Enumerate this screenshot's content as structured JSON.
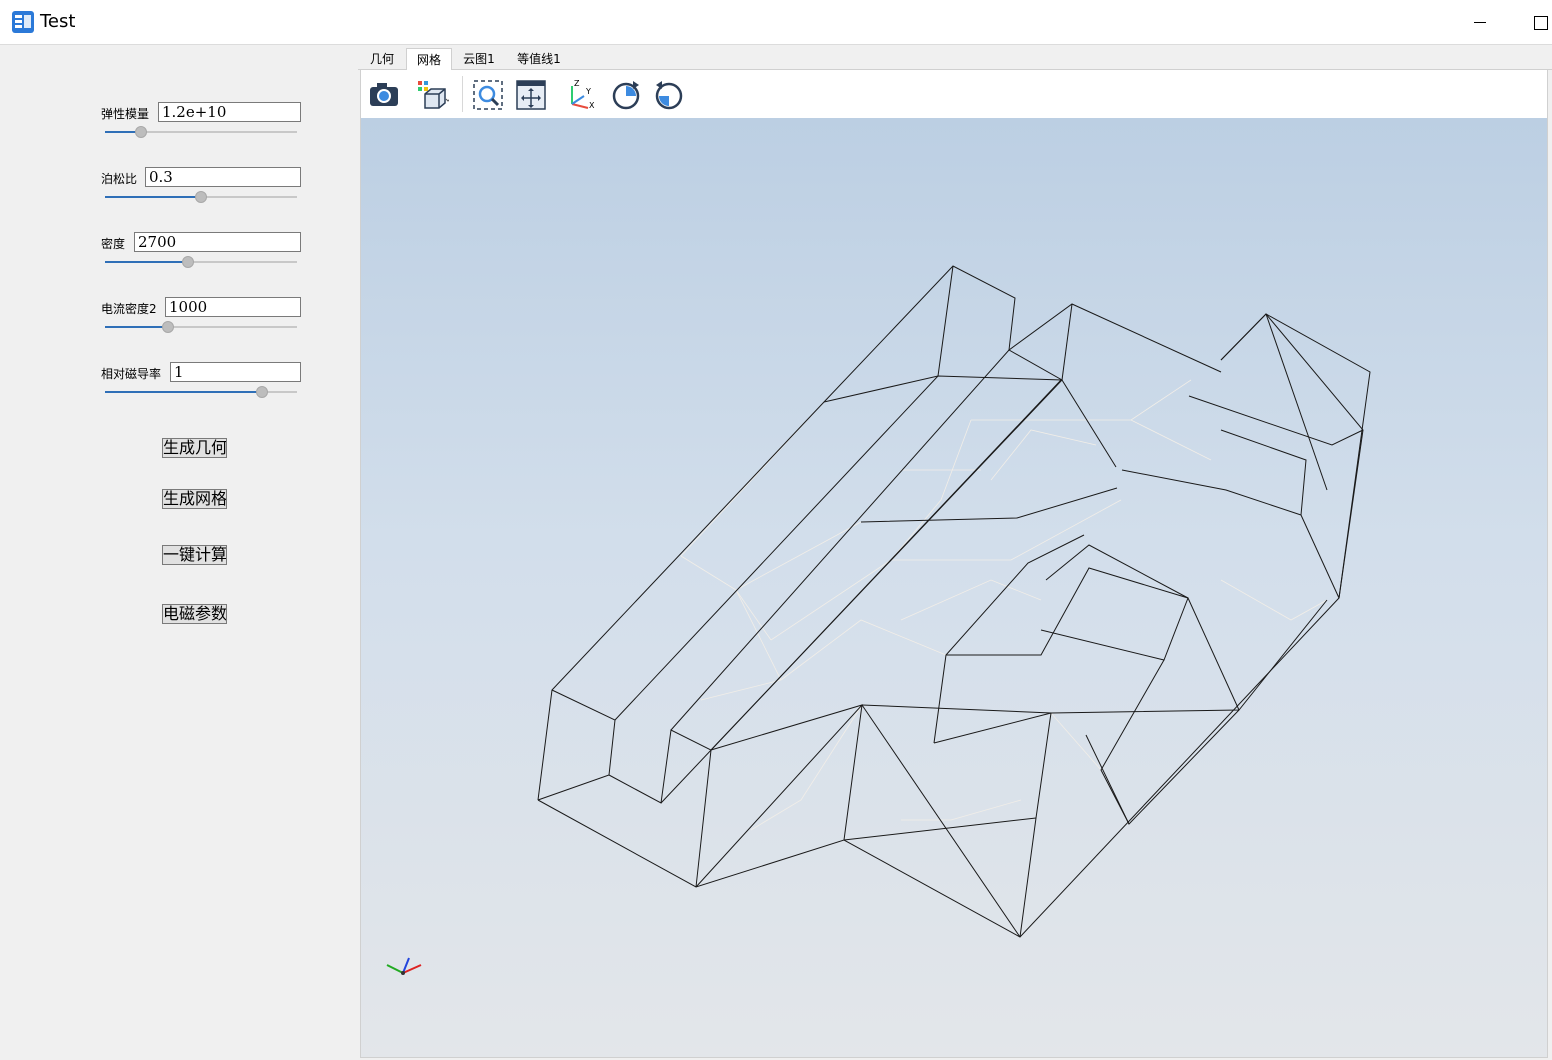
{
  "window": {
    "title": "Test",
    "minimize_icon": "minimize-icon",
    "maximize_icon": "maximize-icon"
  },
  "parameters": [
    {
      "label": "弹性模量",
      "value": "1.2e+10",
      "slider_fraction": 0.19
    },
    {
      "label": "泊松比",
      "value": "0.3",
      "slider_fraction": 0.5
    },
    {
      "label": "密度",
      "value": "2700",
      "slider_fraction": 0.43
    },
    {
      "label": "电流密度2",
      "value": "1000",
      "slider_fraction": 0.33
    },
    {
      "label": "相对磁导率",
      "value": "1",
      "slider_fraction": 0.82
    }
  ],
  "buttons": [
    "生成几何",
    "生成网格",
    "一键计算",
    "电磁参数"
  ],
  "tabs": [
    "几何",
    "网格",
    "云图1",
    "等值线1"
  ],
  "active_tab": "网格",
  "toolbar_icons": [
    "camera-icon",
    "view-cube-icon",
    "zoom-fit-icon",
    "pan-icon",
    "axes-icon",
    "rotate-cw-icon",
    "rotate-ccw-icon"
  ],
  "colors": {
    "accent": "#2f6fb7",
    "mesh_edge": "#1a1a1a",
    "mesh_inner": "#f2eee8",
    "viewport_top": "#bccfe3",
    "viewport_bottom": "#e3e6ea"
  }
}
